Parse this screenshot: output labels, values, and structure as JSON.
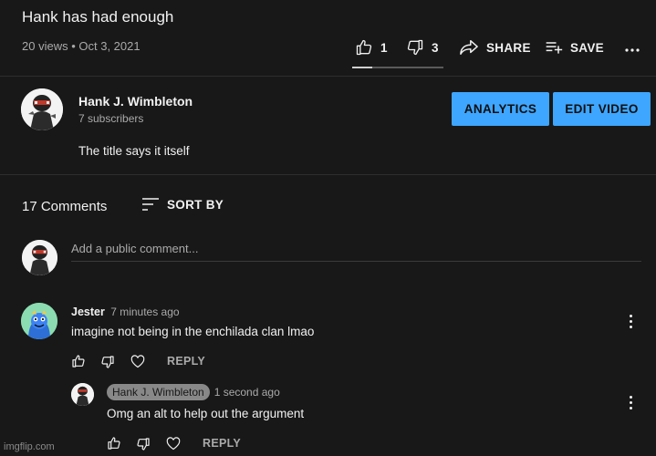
{
  "video": {
    "title": "Hank has had enough",
    "views": "20 views",
    "separator": "•",
    "date": "Oct 3, 2021",
    "like_count": "1",
    "dislike_count": "3",
    "share_label": "SHARE",
    "save_label": "SAVE"
  },
  "channel": {
    "name": "Hank J. Wimbleton",
    "subscribers": "7 subscribers",
    "description": "The title says it itself",
    "analytics_label": "ANALYTICS",
    "edit_label": "EDIT VIDEO"
  },
  "comments": {
    "count_label": "17 Comments",
    "sort_label": "SORT BY",
    "add_placeholder": "Add a public comment...",
    "items": [
      {
        "author": "Jester",
        "time": "7 minutes ago",
        "text": "imagine not being in the enchilada clan lmao",
        "reply_label": "REPLY"
      }
    ],
    "replies": [
      {
        "author": "Hank J. Wimbleton",
        "time": "1 second ago",
        "text": "Omg an alt to help out the argument",
        "reply_label": "REPLY"
      }
    ]
  },
  "watermark": "imgflip.com",
  "colors": {
    "accent": "#3ea6ff",
    "background": "#181818",
    "muted": "#aaaaaa"
  }
}
